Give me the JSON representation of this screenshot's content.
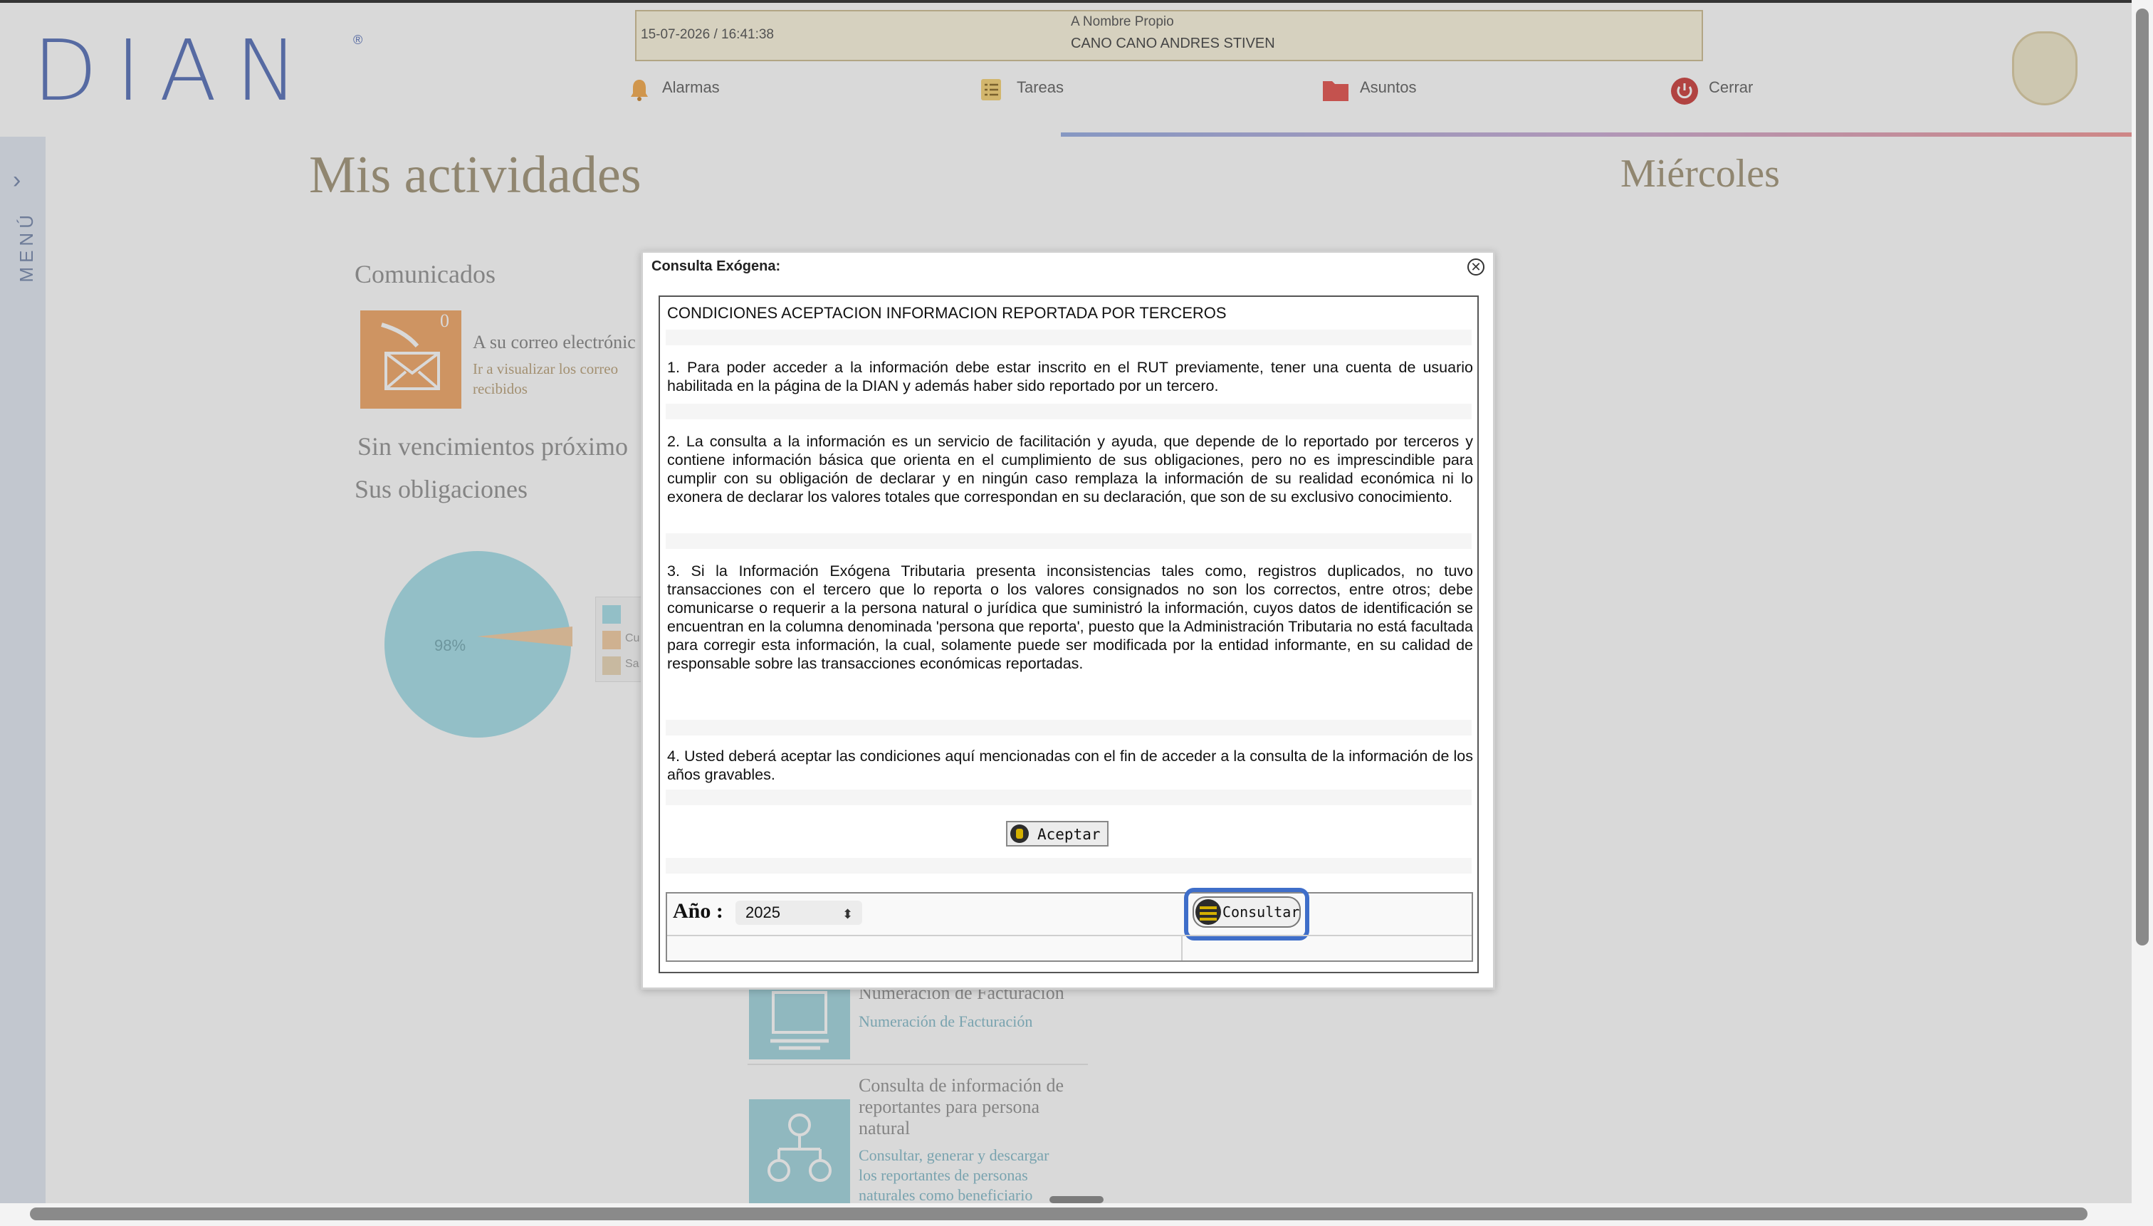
{
  "header": {
    "logo_text": "DIAN",
    "logo_registered": "®",
    "datetime": "15-07-2026 / 16:41:38",
    "on_behalf_label": "A Nombre Propio",
    "user_name": "CANO CANO ANDRES STIVEN",
    "nav": [
      {
        "label": "Alarmas",
        "icon": "bell-icon"
      },
      {
        "label": "Tareas",
        "icon": "checklist-icon"
      },
      {
        "label": "Asuntos",
        "icon": "folder-icon"
      },
      {
        "label": "Cerrar",
        "icon": "power-icon"
      }
    ]
  },
  "left_menu": {
    "chevron": "›",
    "label": "MENÚ"
  },
  "background": {
    "title": "Mis actividades",
    "day": "Miércoles",
    "comunicados_title": "Comunicados",
    "mail_count": "0",
    "mail_title": "A su correo electrónic",
    "mail_sub_line1": "Ir a visualizar los correo",
    "mail_sub_line2": "recibidos",
    "sin_vencimientos": "Sin vencimientos próximo",
    "sus_obligaciones": "Sus obligaciones",
    "pie_label": "98%",
    "legend": [
      {
        "label": "",
        "color": "#9fdbe6"
      },
      {
        "label": "Cu",
        "color": "#f1c89a"
      },
      {
        "label": "Sa",
        "color": "#e8d3b0"
      }
    ],
    "tile1_title": "Numeración de Facturación",
    "tile1_sub": "Numeración de Facturación",
    "tile2_title_lines": [
      "Consulta de información de",
      "reportantes para persona",
      "natural"
    ],
    "tile2_sub_lines": [
      "Consultar, generar y descargar",
      "los reportantes de personas",
      "naturales como beneficiario"
    ]
  },
  "dialog": {
    "title": "Consulta Exógena:",
    "close_symbol": "✕",
    "conditions_title": "CONDICIONES ACEPTACION INFORMACION REPORTADA POR TERCEROS",
    "paragraphs": [
      "1. Para poder acceder a la información debe estar inscrito en el RUT previamente, tener una cuenta de usuario habilitada en la página de la DIAN y además haber sido reportado por un tercero.",
      "2. La consulta a la información es un servicio de facilitación y ayuda, que depende de lo reportado por terceros y contiene información básica que orienta en el cumplimiento de sus obligaciones, pero no es imprescindible para cumplir con su obligación de declarar y en ningún caso remplaza la información de su realidad económica ni lo exonera de declarar los valores totales que correspondan en su declaración, que son de su exclusivo conocimiento.",
      "3. Si la Información Exógena Tributaria presenta inconsistencias tales como, registros duplicados, no tuvo transacciones con el tercero que lo reporta o los valores consignados no son los correctos, entre otros; debe comunicarse o requerir a la persona natural o jurídica que suministró la información, cuyos datos de identificación se encuentran en la columna denominada 'persona que reporta', puesto que la Administración Tributaria no está facultada para corregir esta información, la cual, solamente puede ser modificada por la entidad informante, en su calidad de responsable sobre las transacciones económicas reportadas.",
      "4. Usted deberá aceptar las condiciones aquí mencionadas con el fin de acceder a la consulta de la información de los años gravables."
    ],
    "accept_label": "Aceptar",
    "year_label": "Año :",
    "year_value": "2025",
    "consult_label": "Consultar"
  }
}
